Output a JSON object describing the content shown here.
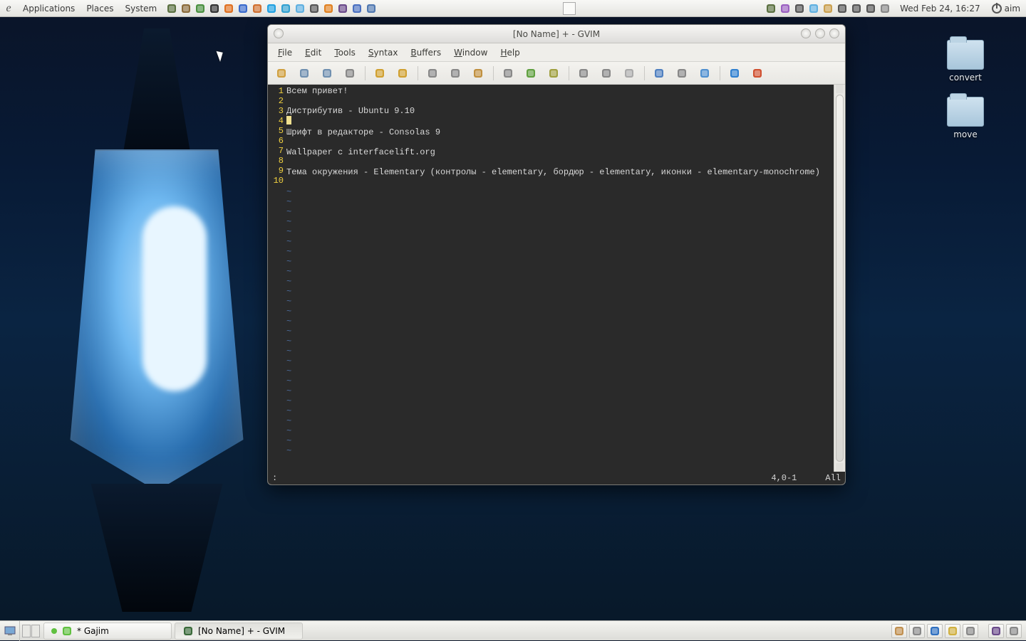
{
  "top_panel": {
    "menus": [
      "Applications",
      "Places",
      "System"
    ],
    "clock": "Wed Feb 24, 16:27",
    "user": "aim",
    "tray_icons_left": [
      "tools-icon",
      "pencil-icon",
      "leaf-icon",
      "terminal-icon",
      "firefox-icon",
      "browser-icon",
      "spiral-icon",
      "skype-icon",
      "chat-icon",
      "water-icon",
      "speaker-icon",
      "vlc-icon",
      "grid-icon",
      "people-icon",
      "cube-icon"
    ],
    "tray_icons_right": [
      "tools-icon",
      "pidgin-icon",
      "headphones-icon",
      "water-icon",
      "clipboard-icon",
      "volume-icon",
      "pen-icon",
      "battery-icon",
      "mail-icon"
    ]
  },
  "desktop_icons": [
    {
      "label": "convert"
    },
    {
      "label": "move"
    }
  ],
  "gvim": {
    "title": "[No Name] + - GVIM",
    "menus": [
      "File",
      "Edit",
      "Tools",
      "Syntax",
      "Buffers",
      "Window",
      "Help"
    ],
    "toolbar": [
      "open-icon",
      "save-icon",
      "saveall-icon",
      "print-icon",
      "sep",
      "undo-icon",
      "redo-icon",
      "sep",
      "cut-icon",
      "copy-icon",
      "paste-icon",
      "sep",
      "find-icon",
      "next-icon",
      "prev-icon",
      "sep",
      "session-open-icon",
      "session-save-icon",
      "script-icon",
      "sep",
      "make-icon",
      "shell-icon",
      "tag-icon",
      "sep",
      "help-icon",
      "warn-icon"
    ],
    "lines": [
      "Всем привет!",
      "",
      "Дистрибутив - Ubuntu 9.10",
      "",
      "Шрифт в редакторе - Consolas 9",
      "",
      "Wallpaper с interfacelift.org",
      "",
      "Тема окружения - Elementary (контролы - elementary, бордюр - elementary, иконки - elementary-monochrome)",
      ""
    ],
    "cursor_line_index": 3,
    "status_left": ":",
    "status_pos": "4,0-1",
    "status_pct": "All"
  },
  "bottom_panel": {
    "tasks": [
      {
        "label": "* Gajim",
        "icon": "gajim-icon",
        "status": "green"
      },
      {
        "label": "[No Name] + - GVIM",
        "icon": "gvim-icon"
      }
    ],
    "tray_right": [
      "home-icon",
      "mail-icon",
      "globe-icon",
      "note-icon",
      "trash-icon",
      "sep",
      "grid-icon",
      "trash-icon"
    ]
  }
}
